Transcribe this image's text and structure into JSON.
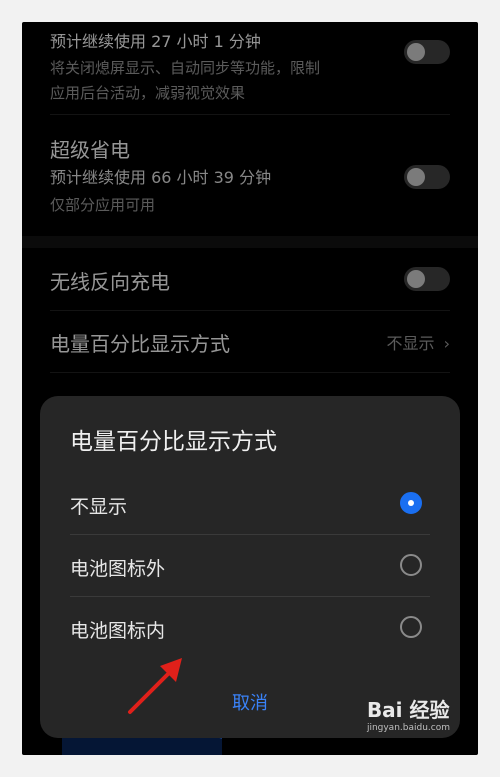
{
  "settings": {
    "power_mode": {
      "estimate": "预计继续使用 27 小时 1 分钟",
      "description_line1": "将关闭熄屏显示、自动同步等功能，限制",
      "description_line2": "应用后台活动，减弱视觉效果"
    },
    "super_saver": {
      "title": "超级省电",
      "estimate": "预计继续使用 66 小时 39 分钟",
      "description": "仅部分应用可用"
    },
    "wireless_reverse": {
      "title": "无线反向充电"
    },
    "battery_percentage": {
      "title": "电量百分比显示方式",
      "value": "不显示"
    }
  },
  "dialog": {
    "title": "电量百分比显示方式",
    "options": [
      {
        "label": "不显示",
        "selected": true
      },
      {
        "label": "电池图标外",
        "selected": false
      },
      {
        "label": "电池图标内",
        "selected": false
      }
    ],
    "cancel_label": "取消"
  },
  "watermark": {
    "brand": "Bai 经验",
    "url": "jingyan.baidu.com"
  },
  "colors": {
    "accent": "#1a6ff1",
    "cancel": "#3a82f7",
    "annotation_arrow": "#e0201a"
  }
}
